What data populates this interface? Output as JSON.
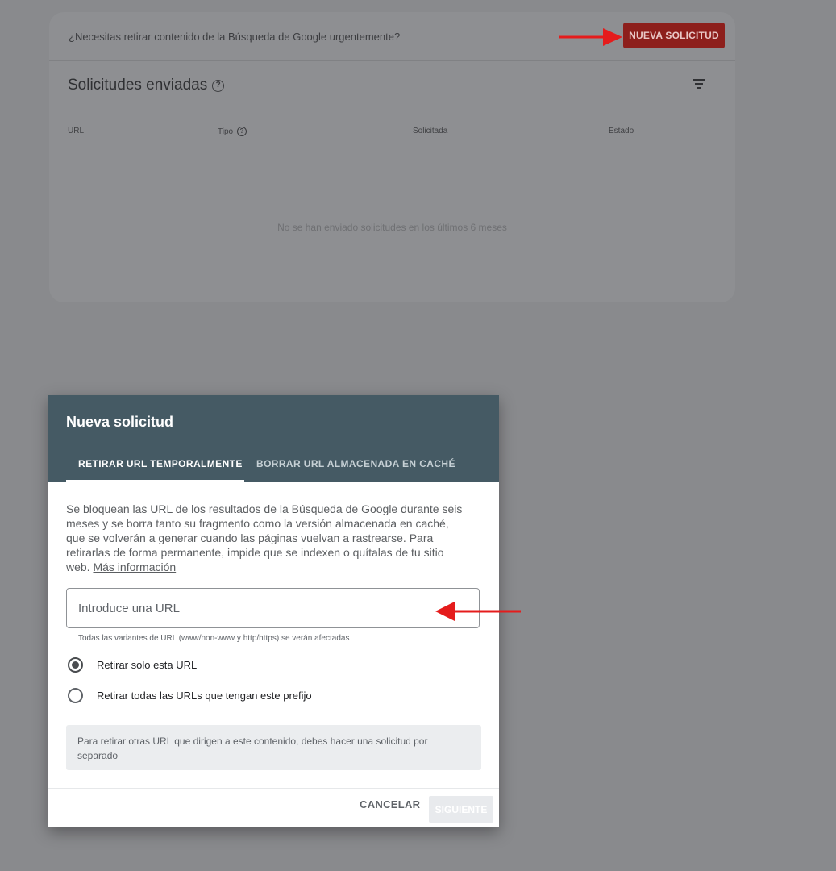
{
  "colors": {
    "accent_red": "#b3261e",
    "dialog_header": "#455a64",
    "arrow_red": "#e51c1c"
  },
  "background_card": {
    "urgent_text": "¿Necesitas retirar contenido de la Búsqueda de Google urgentemente?",
    "new_request_label": "NUEVA SOLICITUD",
    "section_title": "Solicitudes enviadas",
    "help_icon": "?",
    "filter_icon": "filter-icon",
    "columns": [
      "URL",
      "Tipo",
      "Solicitada",
      "Estado"
    ],
    "empty_message": "No se han enviado solicitudes en los últimos 6 meses"
  },
  "dialog": {
    "title": "Nueva solicitud",
    "tabs": [
      {
        "label": "RETIRAR URL TEMPORALMENTE",
        "active": true
      },
      {
        "label": "BORRAR URL ALMACENADA EN CACHÉ",
        "active": false
      }
    ],
    "description": "Se bloquean las URL de los resultados de la Búsqueda de Google durante seis meses y se borra tanto su fragmento como la versión almacenada en caché, que se volverán a generar cuando las páginas vuelvan a rastrearse. Para retirarlas de forma permanente, impide que se indexen o quítalas de tu sitio web. ",
    "learn_more": "Más información",
    "url_input": {
      "placeholder": "Introduce una URL",
      "value": ""
    },
    "input_helper": "Todas las variantes de URL (www/non-www y http/https) se verán afectadas",
    "radio_options": [
      {
        "label": "Retirar solo esta URL",
        "selected": true
      },
      {
        "label": "Retirar todas las URLs que tengan este prefijo",
        "selected": false
      }
    ],
    "info_box": "Para retirar otras URL que dirigen a este contenido, debes hacer una solicitud por separado",
    "cancel_label": "CANCELAR",
    "next_label": "SIGUIENTE"
  }
}
